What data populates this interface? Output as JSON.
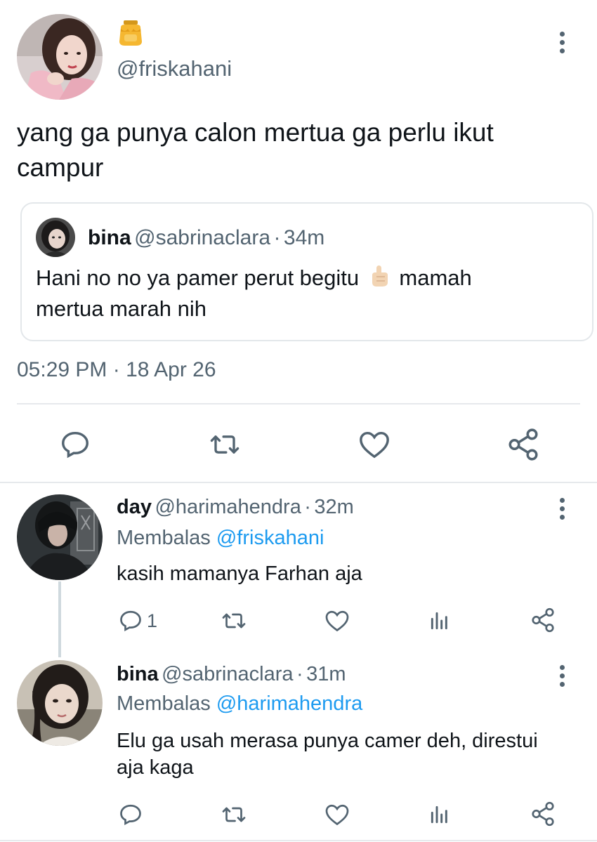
{
  "main_tweet": {
    "display_name_emoji": "honey-pot-emoji",
    "handle": "@friskahani",
    "text": "yang ga punya calon mertua ga perlu ikut campur",
    "timestamp": "05:29 PM",
    "date": "18 Apr 26",
    "separator": "·"
  },
  "quoted_tweet": {
    "name": "bina",
    "handle": "@sabrinaclara",
    "separator": "·",
    "time": "34m",
    "text_before_emoji": "Hani no no ya pamer perut begitu",
    "emoji": "index-finger-pointing-up-emoji",
    "text_after_emoji": "mamah mertua marah nih"
  },
  "replies": [
    {
      "name": "day",
      "handle": "@harimahendra",
      "separator": "·",
      "time": "32m",
      "reply_prefix": "Membalas",
      "reply_to": "@friskahani",
      "text": "kasih mamanya Farhan aja",
      "reply_count": "1"
    },
    {
      "name": "bina",
      "handle": "@sabrinaclara",
      "separator": "·",
      "time": "31m",
      "reply_prefix": "Membalas",
      "reply_to": "@harimahendra",
      "text": "Elu ga usah merasa punya camer deh, direstui aja kaga",
      "reply_count": ""
    }
  ],
  "colors": {
    "accent": "#1d9bf0",
    "secondary_text": "#536471",
    "primary_text": "#0f1419",
    "border": "#e3e7ea"
  }
}
